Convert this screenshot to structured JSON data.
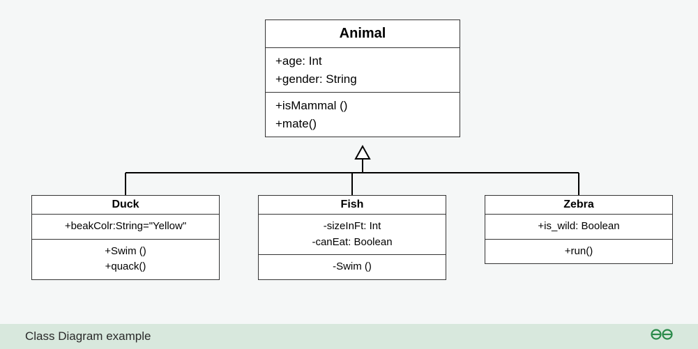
{
  "diagram": {
    "caption": "Class Diagram example",
    "brand": "GeeksforGeeks",
    "parent": {
      "name": "Animal",
      "attributes": [
        "+age: Int",
        "+gender: String"
      ],
      "methods": [
        "+isMammal ()",
        "+mate()"
      ]
    },
    "children": [
      {
        "key": "duck",
        "name": "Duck",
        "attributes": [
          "+beakColr:String=\"Yellow\""
        ],
        "methods": [
          "+Swim ()",
          "+quack()"
        ],
        "align": "center"
      },
      {
        "key": "fish",
        "name": "Fish",
        "attributes": [
          "-sizeInFt: Int",
          "-canEat: Boolean"
        ],
        "methods": [
          "-Swim ()"
        ],
        "align": "center"
      },
      {
        "key": "zebra",
        "name": "Zebra",
        "attributes": [
          "+is_wild: Boolean"
        ],
        "methods": [
          "+run()"
        ],
        "align": "center"
      }
    ]
  }
}
